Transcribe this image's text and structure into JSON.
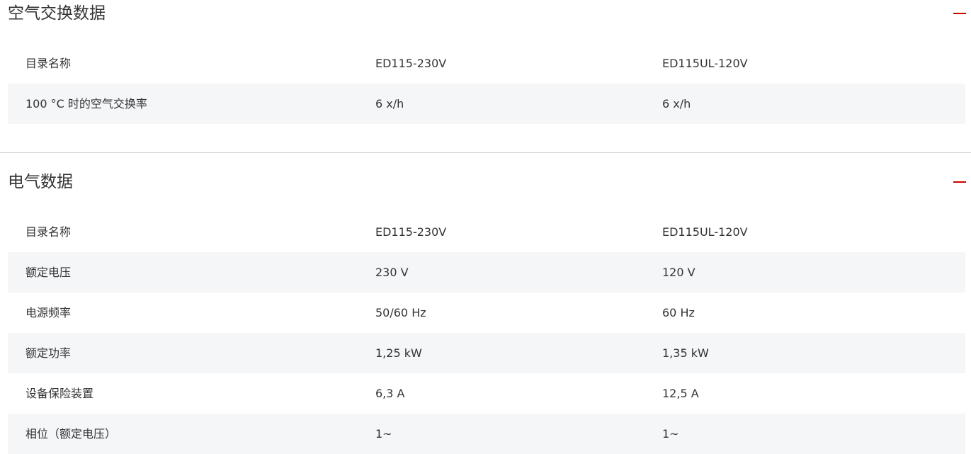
{
  "air_exchange": {
    "title": "空气交换数据",
    "rows": [
      [
        "目录名称",
        "ED115-230V",
        "ED115UL-120V"
      ],
      [
        "100 °C 时的空气交换率",
        "6 x/h",
        "6 x/h"
      ]
    ]
  },
  "electrical": {
    "title": "电气数据",
    "rows": [
      [
        "目录名称",
        "ED115-230V",
        "ED115UL-120V"
      ],
      [
        "额定电压",
        "230 V",
        "120 V"
      ],
      [
        "电源频率",
        "50/60 Hz",
        "60 Hz"
      ],
      [
        "额定功率",
        "1,25 kW",
        "1,35 kW"
      ],
      [
        "设备保险装置",
        "6,3 A",
        "12,5 A"
      ],
      [
        "相位（额定电压）",
        "1~",
        "1~"
      ]
    ]
  },
  "colors": {
    "accent": "#cc0000",
    "row_shade": "#f5f6f7",
    "divider": "#d6d6d6",
    "text": "#333333"
  },
  "icons": {
    "collapse": "minus-icon"
  }
}
